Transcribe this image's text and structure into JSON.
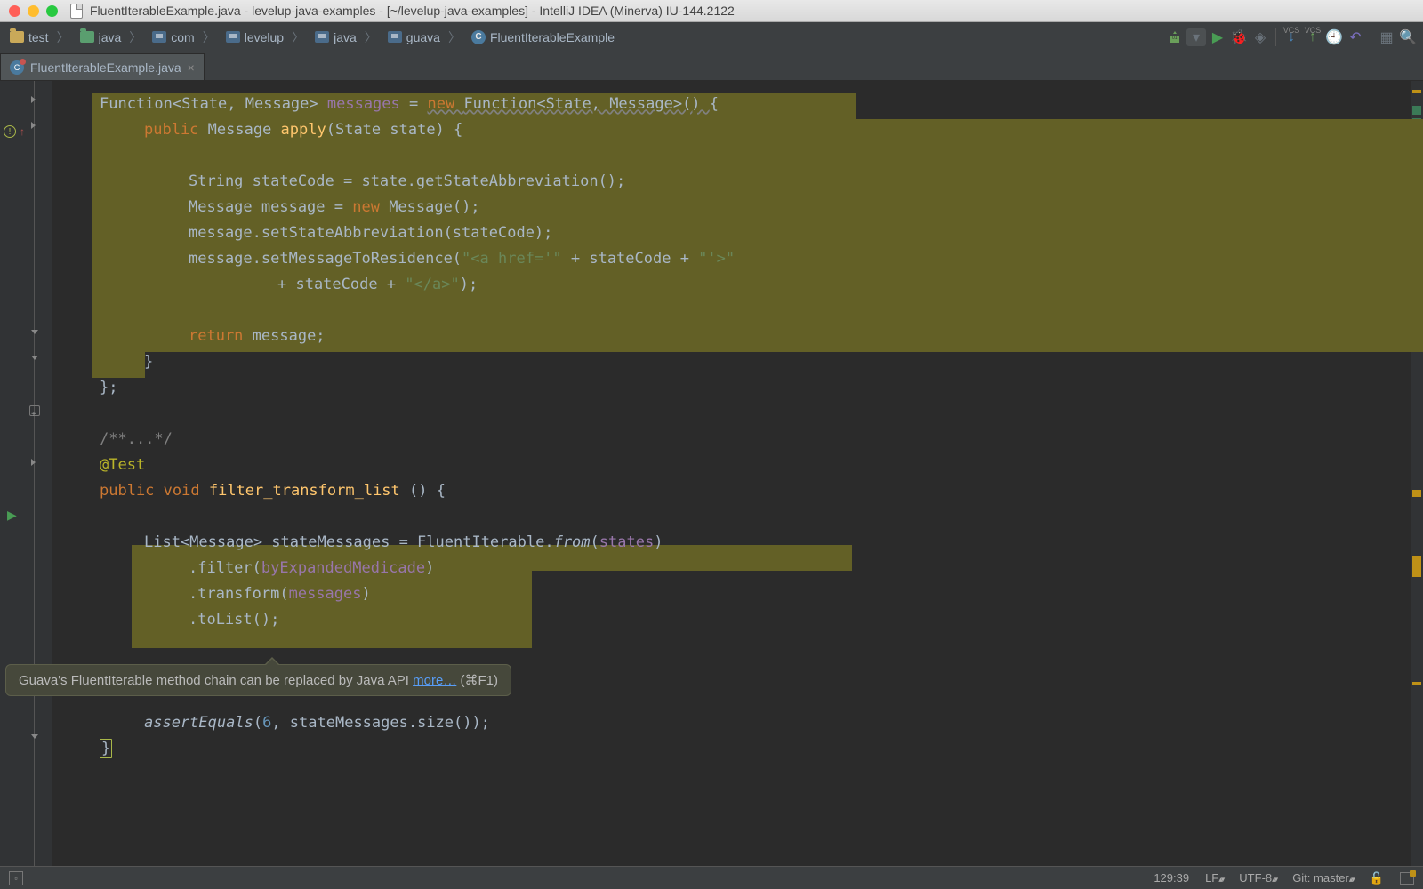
{
  "window": {
    "title": "FluentIterableExample.java - levelup-java-examples - [~/levelup-java-examples] - IntelliJ IDEA (Minerva) IU-144.2122"
  },
  "breadcrumbs": [
    {
      "icon": "folder",
      "label": "test"
    },
    {
      "icon": "folder-green",
      "label": "java"
    },
    {
      "icon": "package",
      "label": "com"
    },
    {
      "icon": "package",
      "label": "levelup"
    },
    {
      "icon": "package",
      "label": "java"
    },
    {
      "icon": "package",
      "label": "guava"
    },
    {
      "icon": "class",
      "label": "FluentIterableExample"
    }
  ],
  "toolbar": {
    "vcs1": "VCS",
    "vcs2": "VCS"
  },
  "tab": {
    "name": "FluentIterableExample.java"
  },
  "code": {
    "l1a": "Function<State, Message> ",
    "l1b": "messages",
    "l1c": " = ",
    "l1d": "new ",
    "l1e": "Function<State, Message>() ",
    "l1f": "{",
    "l2a": "public ",
    "l2b": "Message ",
    "l2c": "apply",
    "l2d": "(State state) {",
    "l3a": "String stateCode = state.getStateAbbreviation();",
    "l4a": "Message message = ",
    "l4b": "new ",
    "l4c": "Message();",
    "l5a": "message.setStateAbbreviation(stateCode);",
    "l6a": "message.setMessageToResidence(",
    "l6b": "\"<a href='\"",
    "l6c": " + stateCode + ",
    "l6d": "\"'>\"",
    "l7a": "+ stateCode + ",
    "l7b": "\"</a>\"",
    "l7c": ");",
    "l8a": "return ",
    "l8b": "message;",
    "l9": "}",
    "l10": "};",
    "l11": "/**...*/",
    "l12": "@Test",
    "l13a": "public ",
    "l13b": "void ",
    "l13c": "filter_transform_list",
    "l13d": " () {",
    "l14a": "List<Message> stateMessages = FluentIterable.",
    "l14b": "from",
    "l14c": "(",
    "l14d": "states",
    "l14e": ")",
    "l15a": ".filter(",
    "l15b": "byExpandedMedicade",
    "l15c": ")",
    "l16a": ".transform(",
    "l16b": "messages",
    "l16c": ")",
    "l17": ".toList();",
    "l18a": "assertEquals",
    "l18b": "(",
    "l18c": "6",
    "l18d": ", stateMessages.size());",
    "l19": "}"
  },
  "tooltip": {
    "text": "Guava's FluentIterable method chain can be replaced by Java API ",
    "link": "more…",
    "shortcut": " (⌘F1)"
  },
  "status": {
    "pos": "129:39",
    "lf": "LF",
    "enc": "UTF-8",
    "git": "Git: master"
  }
}
